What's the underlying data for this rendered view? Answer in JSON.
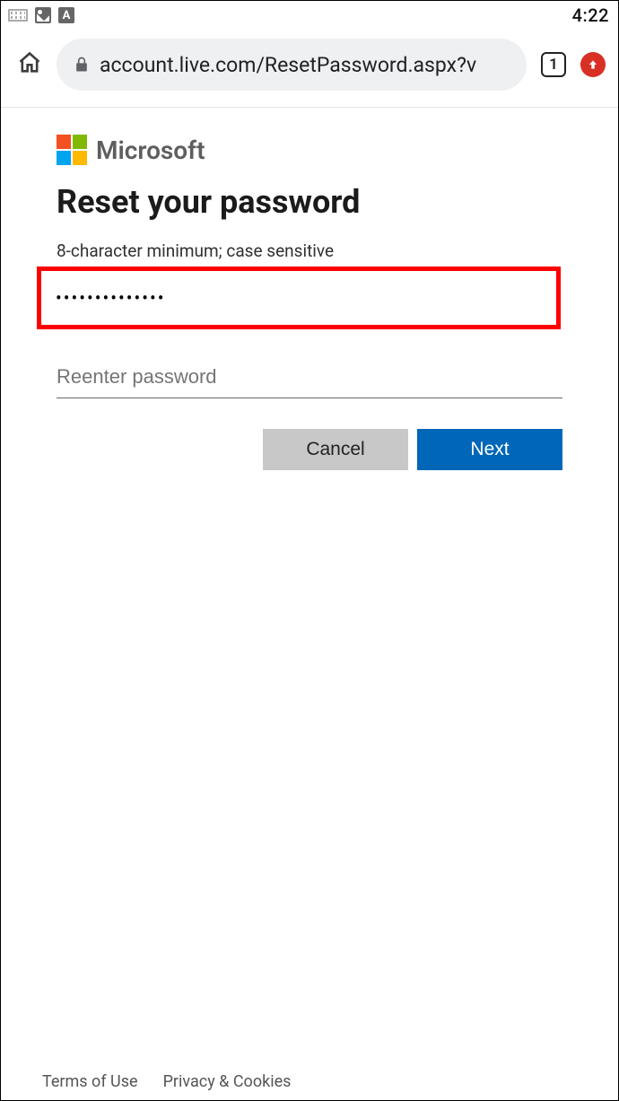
{
  "status": {
    "time": "4:22",
    "a": "A"
  },
  "toolbar": {
    "url": "account.live.com/ResetPassword.aspx?v",
    "tabs": "1"
  },
  "brand": {
    "name": "Microsoft"
  },
  "page": {
    "title": "Reset your password",
    "hint": "8-character minimum; case sensitive",
    "password_mask": "••••••••••••••",
    "reenter_placeholder": "Reenter password"
  },
  "buttons": {
    "cancel": "Cancel",
    "next": "Next"
  },
  "footer": {
    "terms": "Terms of Use",
    "privacy": "Privacy & Cookies"
  },
  "annotation": {
    "highlight_color": "#ff0000"
  }
}
